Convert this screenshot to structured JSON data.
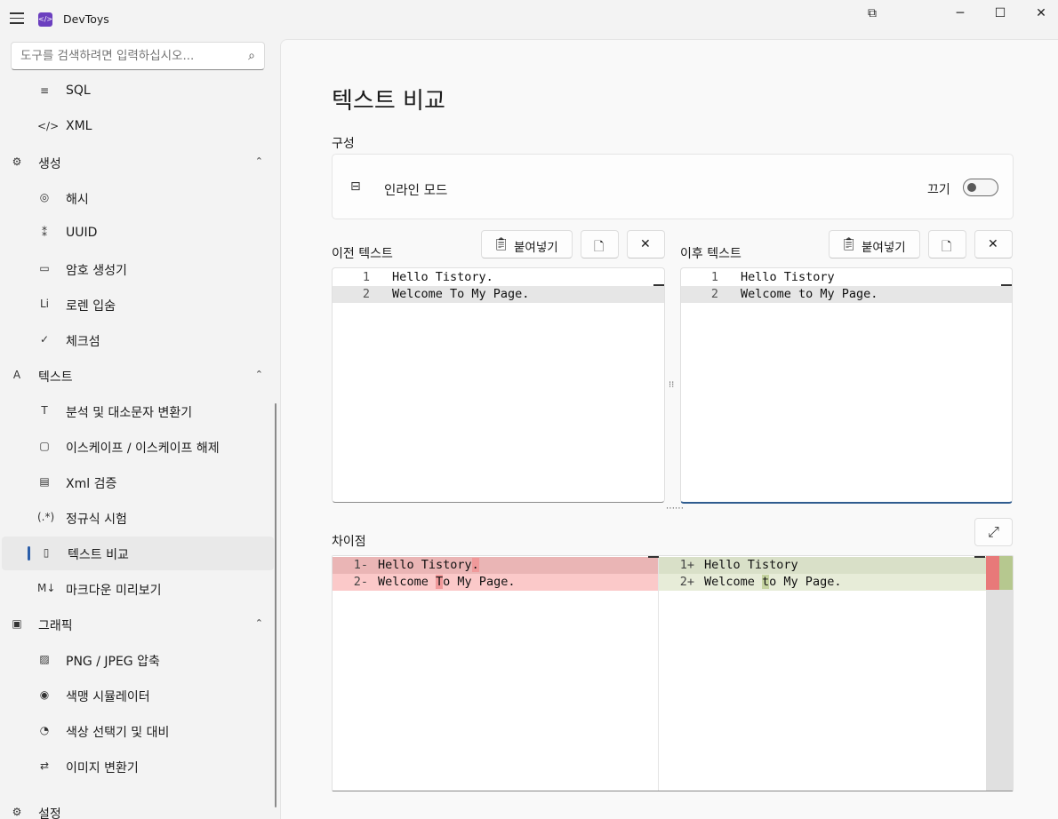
{
  "window": {
    "app_title": "DevToys",
    "app_logo_text": "</>"
  },
  "sidebar": {
    "search_placeholder": "도구를 검색하려면 입력하십시오...",
    "items": [
      {
        "key": "sql",
        "label": "SQL",
        "icon": "≡",
        "indent": true
      },
      {
        "key": "xml",
        "label": "XML",
        "icon": "</>",
        "indent": true
      },
      {
        "key": "generators",
        "label": "생성",
        "icon": "⚙",
        "indent": false,
        "expanded": true
      },
      {
        "key": "hash",
        "label": "해시",
        "icon": "◎",
        "indent": true
      },
      {
        "key": "uuid",
        "label": "UUID",
        "icon": "⁑",
        "indent": true
      },
      {
        "key": "password",
        "label": "암호 생성기",
        "icon": "▭",
        "indent": true
      },
      {
        "key": "lorem",
        "label": "로렌 입숨",
        "icon": "Li",
        "indent": true
      },
      {
        "key": "checksum",
        "label": "체크섬",
        "icon": "✓",
        "indent": true
      },
      {
        "key": "text",
        "label": "텍스트",
        "icon": "A",
        "indent": false,
        "expanded": true
      },
      {
        "key": "analyze",
        "label": "분석 및 대소문자 변환기",
        "icon": "T",
        "indent": true
      },
      {
        "key": "escape",
        "label": "이스케이프 / 이스케이프 해제",
        "icon": "▢",
        "indent": true
      },
      {
        "key": "xml-validate",
        "label": "Xml 검증",
        "icon": "▤",
        "indent": true
      },
      {
        "key": "regex",
        "label": "정규식 시험",
        "icon": "(.*)",
        "indent": true
      },
      {
        "key": "text-diff",
        "label": "텍스트 비교",
        "icon": "▯",
        "indent": true,
        "selected": true
      },
      {
        "key": "markdown",
        "label": "마크다운 미리보기",
        "icon": "M↓",
        "indent": true
      },
      {
        "key": "graphics",
        "label": "그래픽",
        "icon": "▣",
        "indent": false,
        "expanded": true
      },
      {
        "key": "png-jpeg",
        "label": "PNG / JPEG 압축",
        "icon": "▨",
        "indent": true
      },
      {
        "key": "colorblind",
        "label": "색맹 시뮬레이터",
        "icon": "◉",
        "indent": true
      },
      {
        "key": "color-picker",
        "label": "색상 선택기 및 대비",
        "icon": "◔",
        "indent": true
      },
      {
        "key": "image-convert",
        "label": "이미지 변환기",
        "icon": "⇄",
        "indent": true
      }
    ],
    "settings_label": "설정",
    "chevron": "⌃"
  },
  "main": {
    "title": "텍스트 비교",
    "config_label": "구성",
    "inline_mode_label": "인라인 모드",
    "toggle_state_label": "끄기",
    "toggle_on": false,
    "old_text_label": "이전 텍스트",
    "new_text_label": "이후 텍스트",
    "paste_label": "붙여넣기",
    "diff_label": "차이점",
    "old_lines": [
      {
        "num": "1",
        "text": "Hello Tistory."
      },
      {
        "num": "2",
        "text": "Welcome To My Page."
      }
    ],
    "new_lines": [
      {
        "num": "1",
        "text": "Hello Tistory"
      },
      {
        "num": "2",
        "text": "Welcome to My Page."
      }
    ],
    "diff_left": [
      {
        "num": "1",
        "sign": "-",
        "text": "Hello Tistory."
      },
      {
        "num": "2",
        "sign": "-",
        "text": "Welcome To My Page."
      }
    ],
    "diff_right": [
      {
        "num": "1",
        "sign": "+",
        "text": "Hello Tistory"
      },
      {
        "num": "2",
        "sign": "+",
        "text": "Welcome to My Page."
      }
    ]
  },
  "colors": {
    "accent": "#2b5ea9",
    "deleted_line": "#fbc9c9",
    "deleted_char": "#f0999a",
    "added_line": "#e7ecd8",
    "added_char": "#c5d3a0",
    "overview_del": "#e87979",
    "overview_add": "#b6c88f"
  }
}
